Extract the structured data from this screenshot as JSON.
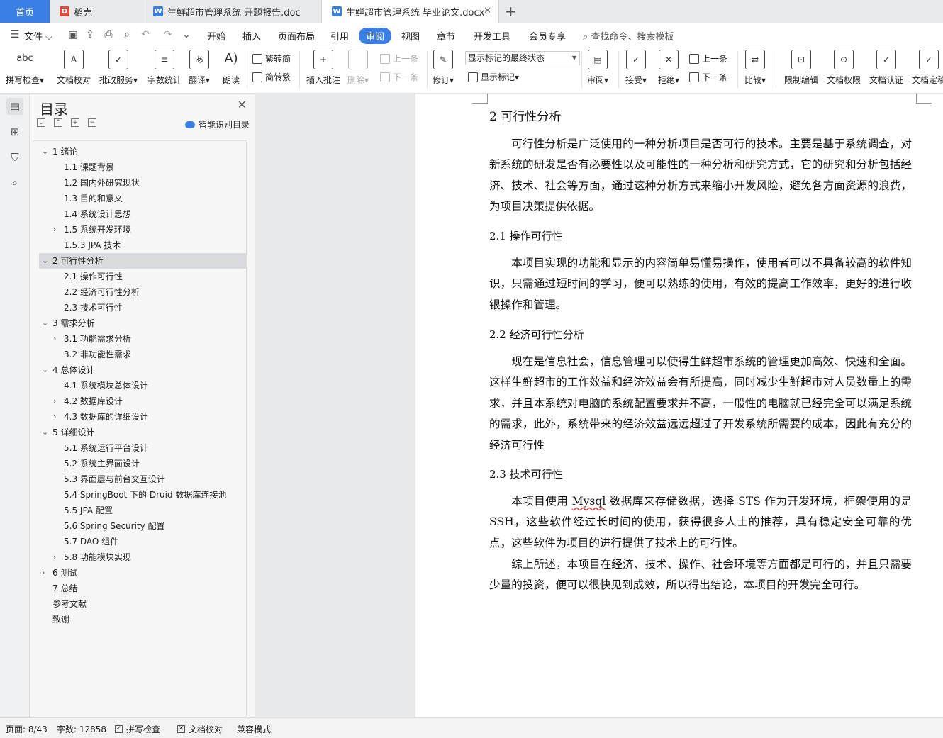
{
  "tabs": {
    "home": "首页",
    "daoke": "稻壳",
    "doc1": "生鲜超市管理系统 开题报告.doc",
    "doc2": "生鲜超市管理系统 毕业论文.docx",
    "add": "+"
  },
  "menu": {
    "file": "文件",
    "items": [
      "开始",
      "插入",
      "页面布局",
      "引用",
      "审阅",
      "视图",
      "章节",
      "开发工具",
      "会员专享"
    ],
    "search": "查找命令、搜索模板"
  },
  "ribbon": {
    "spell_check": "拼写检查",
    "doc_proof": "文档校对",
    "batch_service": "批改服务",
    "word_count": "字数统计",
    "translate": "翻译",
    "read_aloud": "朗读",
    "trad_to_simp": "繁转简",
    "simp_to_trad": "简转繁",
    "insert_comment": "插入批注",
    "delete": "删除",
    "prev_comment": "上一条",
    "next_comment": "下一条",
    "revise": "修订",
    "show_state": "显示标记的最终状态",
    "show_marks": "显示标记",
    "review": "审阅",
    "accept": "接受",
    "reject": "拒绝",
    "prev_change": "上一条",
    "next_change": "下一条",
    "compare": "比较",
    "restrict_edit": "限制编辑",
    "doc_rights": "文档权限",
    "doc_cert": "文档认证",
    "doc_final": "文档定稿"
  },
  "toc": {
    "title": "目录",
    "smart": "智能识别目录",
    "items": [
      {
        "text": "1 绪论",
        "level": 1,
        "arrow": "down"
      },
      {
        "text": "1.1  课题背景",
        "level": 2,
        "arrow": ""
      },
      {
        "text": "1.2  国内外研究现状",
        "level": 2,
        "arrow": ""
      },
      {
        "text": "1.3  目的和意义",
        "level": 2,
        "arrow": ""
      },
      {
        "text": "1.4  系统设计思想",
        "level": 2,
        "arrow": ""
      },
      {
        "text": "1.5  系统开发环境",
        "level": 2,
        "arrow": "right"
      },
      {
        "text": "1.5.3    JPA 技术",
        "level": 2,
        "arrow": ""
      },
      {
        "text": "2 可行性分析",
        "level": 1,
        "arrow": "down",
        "active": true
      },
      {
        "text": "2.1  操作可行性",
        "level": 2,
        "arrow": ""
      },
      {
        "text": "2.2  经济可行性分析",
        "level": 2,
        "arrow": ""
      },
      {
        "text": "2.3  技术可行性",
        "level": 2,
        "arrow": ""
      },
      {
        "text": "3 需求分析",
        "level": 1,
        "arrow": "down"
      },
      {
        "text": "3.1  功能需求分析",
        "level": 2,
        "arrow": "right"
      },
      {
        "text": "3.2  非功能性需求",
        "level": 2,
        "arrow": ""
      },
      {
        "text": "4 总体设计",
        "level": 1,
        "arrow": "down"
      },
      {
        "text": "4.1  系统模块总体设计",
        "level": 2,
        "arrow": ""
      },
      {
        "text": "4.2  数据库设计",
        "level": 2,
        "arrow": "right"
      },
      {
        "text": "4.3 数据库的详细设计",
        "level": 2,
        "arrow": "right"
      },
      {
        "text": "5 详细设计",
        "level": 1,
        "arrow": "down"
      },
      {
        "text": "5.1  系统运行平台设计",
        "level": 2,
        "arrow": ""
      },
      {
        "text": "5.2  系统主界面设计",
        "level": 2,
        "arrow": ""
      },
      {
        "text": "5.3  界面层与前台交互设计",
        "level": 2,
        "arrow": ""
      },
      {
        "text": "5.4 SpringBoot 下的 Druid 数据库连接池",
        "level": 2,
        "arrow": ""
      },
      {
        "text": "5.5 JPA 配置",
        "level": 2,
        "arrow": ""
      },
      {
        "text": "5.6 Spring Security 配置",
        "level": 2,
        "arrow": ""
      },
      {
        "text": "5.7 DAO 组件",
        "level": 2,
        "arrow": ""
      },
      {
        "text": "5.8  功能模块实现",
        "level": 2,
        "arrow": "right"
      },
      {
        "text": "6 测试",
        "level": 1,
        "arrow": "right"
      },
      {
        "text": "7 总结",
        "level": 1,
        "arrow": ""
      },
      {
        "text": "参考文献",
        "level": 1,
        "arrow": ""
      },
      {
        "text": "致谢",
        "level": 1,
        "arrow": ""
      }
    ]
  },
  "document": {
    "h_main": "2 可行性分析",
    "p_intro": "可行性分析是广泛使用的一种分析项目是否可行的技术。主要是基于系统调查，对新系统的研发是否有必要性以及可能性的一种分析和研究方式，它的研究和分析包括经济、技术、社会等方面，通过这种分析方式来缩小开发风险，避免各方面资源的浪费，为项目决策提供依据。",
    "h_op": "2.1  操作可行性",
    "p_op": "本项目实现的功能和显示的内容简单易懂易操作，使用者可以不具备较高的软件知识，只需通过短时间的学习，便可以熟练的使用，有效的提高工作效率，更好的进行收银操作和管理。",
    "h_econ": "2.2  经济可行性分析",
    "p_econ": " 现在是信息社会，信息管理可以使得生鲜超市系统的管理更加高效、快速和全面。这样生鲜超市的工作效益和经济效益会有所提高，同时减少生鲜超市对人员数量上的需求，并且本系统对电脑的系统配置要求并不高，一般性的电脑就已经完全可以满足系统的需求，此外，系统带来的经济效益远远超过了开发系统所需要的成本，因此有充分的经济可行性",
    "h_tech": "2.3  技术可行性",
    "p_tech_a": "本项目使用 ",
    "p_tech_word": "Mysql",
    "p_tech_b": " 数据库来存储数据，选择 STS 作为开发环境，框架使用的是 SSH，这些软件经过长时间的使用，获得很多人士的推荐，具有稳定安全可靠的优点，这些软件为项目的进行提供了技术上的可行性。",
    "p_summary": "综上所述，本项目在经济、技术、操作、社会环境等方面都是可行的，并且只需要少量的投资，便可以很快见到成效，所以得出结论，本项目的开发完全可行。"
  },
  "status": {
    "page": "页面: 8/43",
    "words": "字数: 12858",
    "spell": "拼写检查",
    "proof": "文档校对",
    "compat": "兼容模式"
  }
}
